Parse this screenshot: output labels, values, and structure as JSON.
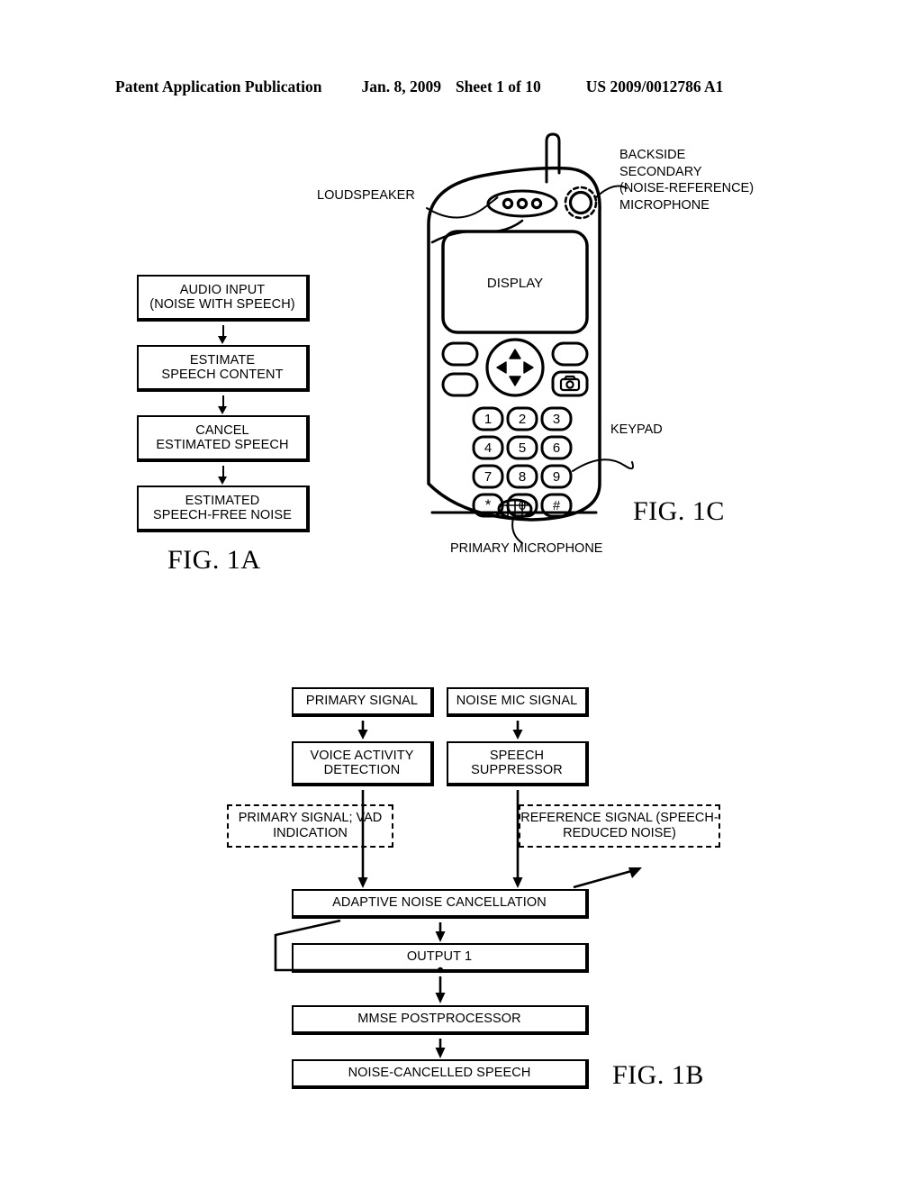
{
  "header": {
    "title": "Patent Application Publication",
    "date": "Jan. 8, 2009",
    "sheet": "Sheet 1 of 10",
    "publication_number": "US 2009/0012786 A1"
  },
  "fig1a": {
    "caption": "FIG. 1A",
    "boxes": [
      {
        "line1": "AUDIO INPUT",
        "line2": "(NOISE WITH SPEECH)"
      },
      {
        "line1": "ESTIMATE",
        "line2": "SPEECH CONTENT"
      },
      {
        "line1": "CANCEL",
        "line2": "ESTIMATED SPEECH"
      },
      {
        "line1": "ESTIMATED",
        "line2": "SPEECH-FREE NOISE"
      }
    ]
  },
  "fig1c": {
    "caption": "FIG. 1C",
    "display_label": "DISPLAY",
    "callouts": {
      "loudspeaker": "LOUDSPEAKER",
      "backside_mic_line1": "BACKSIDE",
      "backside_mic_line2": "SECONDARY",
      "backside_mic_line3": "(NOISE-REFERENCE)",
      "backside_mic_line4": "MICROPHONE",
      "keypad": "KEYPAD",
      "primary_microphone": "PRIMARY MICROPHONE"
    },
    "keypad_keys": [
      "1",
      "2",
      "3",
      "4",
      "5",
      "6",
      "7",
      "8",
      "9",
      "*",
      "0",
      "#"
    ],
    "camera_key_icon": "camera-icon",
    "dpad_icons": [
      "up-arrow-icon",
      "down-arrow-icon",
      "left-arrow-icon",
      "right-arrow-icon"
    ],
    "speaker_icon": "loudspeaker-grille-icon",
    "secondary_mic_icon": "secondary-microphone-icon",
    "primary_mic_icon": "primary-microphone-grille-icon",
    "antenna_icon": "antenna-icon"
  },
  "fig1b": {
    "caption": "FIG. 1B",
    "boxes": {
      "primary_signal": "PRIMARY SIGNAL",
      "noise_mic_signal": "NOISE MIC SIGNAL",
      "vad_line1": "VOICE ACTIVITY",
      "vad_line2": "DETECTION",
      "suppressor_line1": "SPEECH",
      "suppressor_line2": "SUPPRESSOR",
      "adaptive_noise_cancellation": "ADAPTIVE NOISE CANCELLATION",
      "output1": "OUTPUT 1",
      "mmse_postprocessor": "MMSE POSTPROCESSOR",
      "noise_cancelled_speech": "NOISE-CANCELLED SPEECH"
    },
    "dashed_labels": {
      "left_line1": "PRIMARY SIGNAL;",
      "left_line2": "VAD INDICATION",
      "right_line1": "REFERENCE SIGNAL",
      "right_line2": "(SPEECH-REDUCED NOISE)"
    }
  },
  "colors": {
    "ink": "#000000",
    "paper": "#ffffff"
  }
}
